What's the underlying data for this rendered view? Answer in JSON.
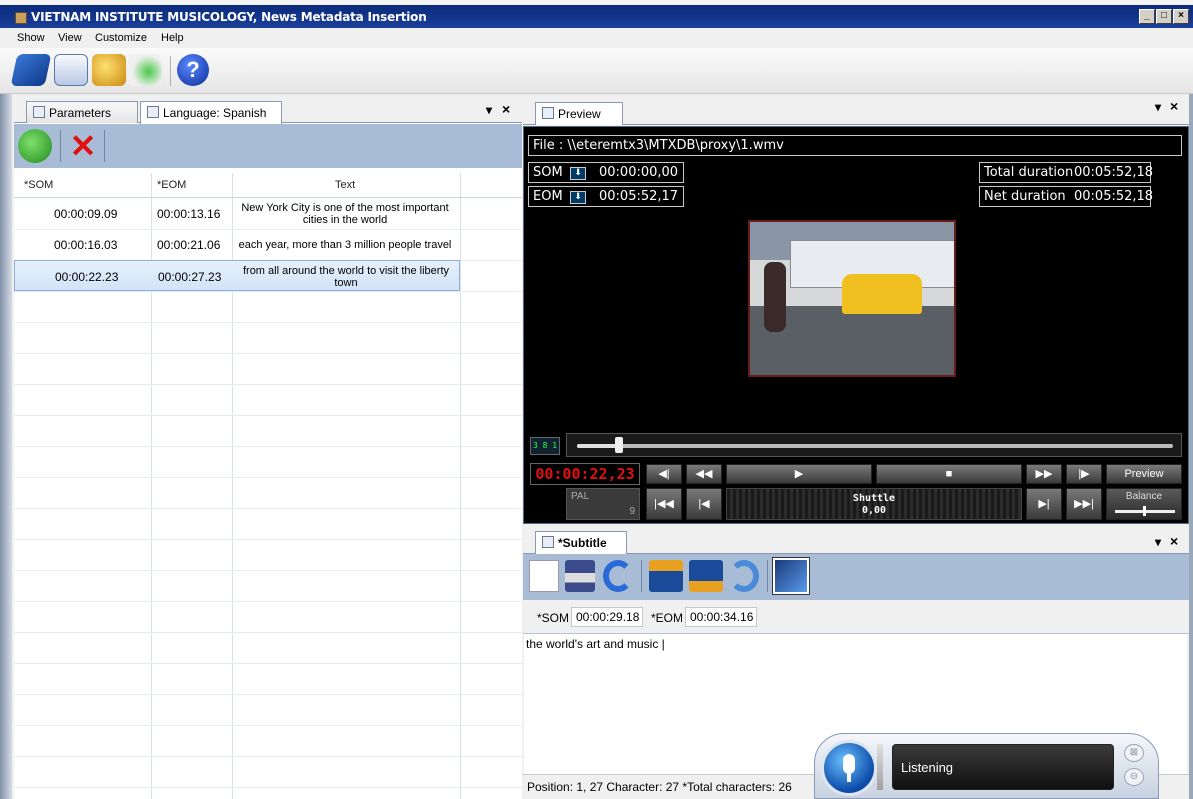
{
  "window": {
    "title": "VIETNAM INSTITUTE MUSICOLOGY, News Metadata Insertion",
    "min": "_",
    "max": "□",
    "close": "×"
  },
  "menu": [
    "Show",
    "View",
    "Customize",
    "Help"
  ],
  "toolbar": {
    "icons": [
      "blue-book-icon",
      "documents-icon",
      "yellow-cube-icon",
      "green-arrow-disk-icon",
      "help-icon"
    ],
    "help_glyph": "?"
  },
  "left_pane": {
    "tabs": [
      "Parameters",
      "Language: Spanish"
    ],
    "pin": "▾",
    "close": "×",
    "columns": [
      "*SOM",
      "*EOM",
      "Text"
    ],
    "rows": [
      {
        "som": "00:00:09.09",
        "eom": "00:00:13.16",
        "text": "New York City is one of the most important cities in the world"
      },
      {
        "som": "00:00:16.03",
        "eom": "00:00:21.06",
        "text": "each year, more than 3 million people travel"
      },
      {
        "som": "00:00:22.23",
        "eom": "00:00:27.23",
        "text": "from all around the world to visit the liberty town"
      }
    ],
    "delete_glyph": "✕"
  },
  "preview": {
    "tab": "Preview",
    "pin": "▾",
    "close": "×",
    "file_label": "File : \\\\eteremtx3\\MTXDB\\proxy\\1.wmv",
    "som_label": "SOM",
    "som_value": "00:00:00,00",
    "eom_label": "EOM",
    "eom_value": "00:05:52,17",
    "arrow_glyph": "⬇",
    "total_duration_label": "Total duration",
    "total_duration_value": "00:05:52,18",
    "net_duration_label": "Net duration",
    "net_duration_value": "00:05:52,18",
    "timecode": "00:00:22,23",
    "position_fraction": 0.07,
    "format": "PAL",
    "format_sub": "9",
    "shuttle_label": "Shuttle",
    "shuttle_value": "0,00",
    "preview_button": "Preview",
    "balance_label": "Balance",
    "buttons": {
      "prev_mark": "◀|",
      "rewind": "◀◀",
      "play": "▶",
      "stop": "■",
      "ffwd": "▶▶",
      "next_mark": "|▶",
      "start": "|◀◀",
      "step_back": "|◀",
      "step_fwd": "▶|",
      "end": "▶▶|"
    },
    "time_icon_text": "3 8 1"
  },
  "subtitle": {
    "tab": "*Subtitle",
    "pin": "▾",
    "close": "×",
    "som_label": "*SOM",
    "som_value": "00:00:29.18",
    "eom_label": "*EOM",
    "eom_value": "00:00:34.16",
    "text": "the world's art and music |",
    "status": "Position: 1, 27  Character: 27  *Total characters: 26"
  },
  "speech": {
    "status": "Listening",
    "close_glyph": "⊠",
    "min_glyph": "⊖"
  },
  "colors": {
    "title_bar": "#0a2a7a",
    "toolbar_band": "#a9bcd6",
    "timecode_red": "#e01010",
    "selected_row": "#d2e4f8"
  }
}
